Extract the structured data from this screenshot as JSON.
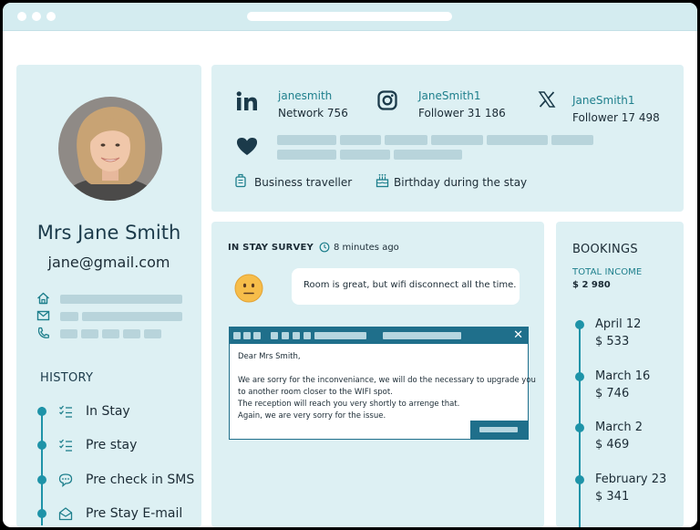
{
  "profile": {
    "name": "Mrs Jane Smith",
    "email": "jane@gmail.com",
    "history_title": "HISTORY",
    "history": [
      {
        "label": "In Stay",
        "icon": "checklist-icon"
      },
      {
        "label": "Pre stay",
        "icon": "checklist-icon"
      },
      {
        "label": "Pre check in SMS",
        "icon": "chat-bubble-icon"
      },
      {
        "label": "Pre Stay E-mail",
        "icon": "envelope-icon"
      }
    ],
    "contact_icons": [
      "home-icon",
      "mail-icon",
      "phone-icon"
    ]
  },
  "social": {
    "linkedin": {
      "handle": "janesmith",
      "stat": "Network 756",
      "icon": "linkedin-icon"
    },
    "instagram": {
      "handle": "JaneSmith1",
      "stat": "Follower 31 186",
      "icon": "instagram-icon"
    },
    "x": {
      "handle": "JaneSmith1",
      "stat": "Follower 17 498",
      "icon": "x-logo-icon"
    },
    "interests_icon": "heart-icon",
    "tags": [
      {
        "label": "Business traveller",
        "icon": "luggage-icon"
      },
      {
        "label": "Birthday during the stay",
        "icon": "cake-icon"
      }
    ]
  },
  "survey": {
    "title": "IN STAY SURVEY",
    "time": "8 minutes ago",
    "message": "Room is great, but wifi disconnect all the time.",
    "reply_lines": [
      "Dear Mrs Smith,",
      "",
      "We are sorry for the inconveniance, we will do the necessary to upgrade you",
      "to another room closer to the WIFI spot.",
      "The reception will reach you very shortly to arrenge that.",
      "Again, we are very sorry for the issue."
    ],
    "close_glyph": "✕"
  },
  "bookings": {
    "title": "BOOKINGS",
    "income_label": "TOTAL INCOME",
    "income_value": "$ 2 980",
    "items": [
      {
        "date": "April 12",
        "amount": "$ 533"
      },
      {
        "date": "March 16",
        "amount": "$ 746"
      },
      {
        "date": "March 2",
        "amount": "$ 469"
      },
      {
        "date": "February 23",
        "amount": "$ 341"
      }
    ]
  },
  "colors": {
    "accent": "#1e93a8",
    "panel": "#ddf0f3",
    "titlebar": "#d4ecf0",
    "email_header": "#1f6f8b"
  }
}
